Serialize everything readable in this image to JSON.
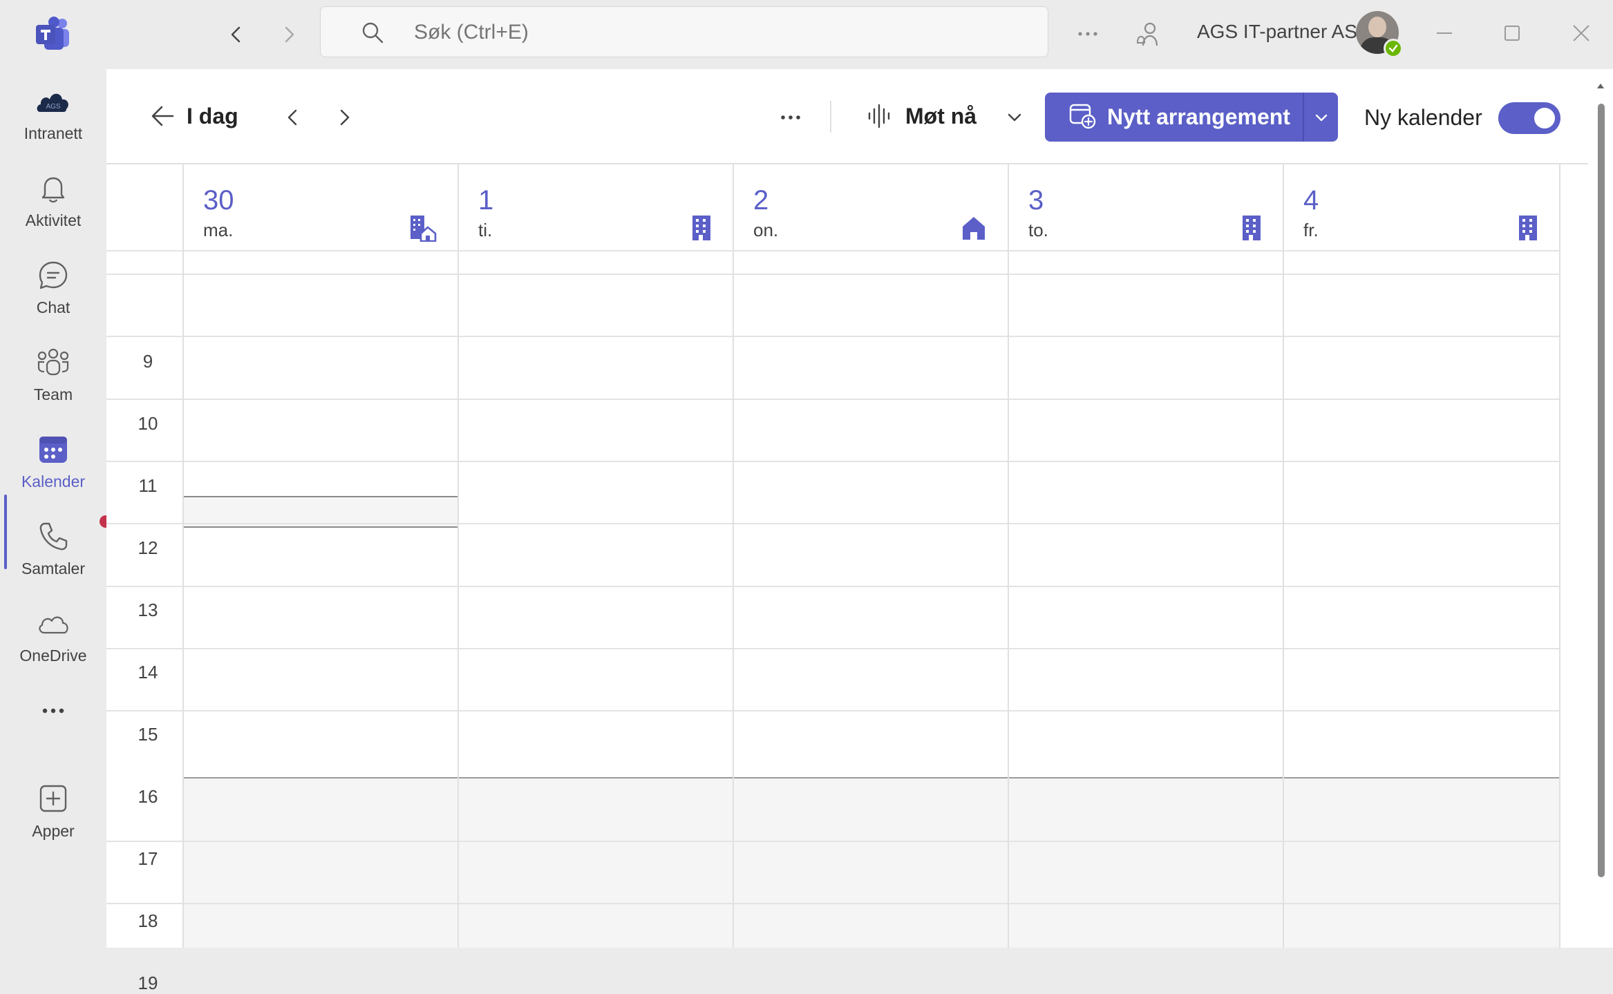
{
  "titlebar": {
    "search_placeholder": "Søk (Ctrl+E)",
    "org_name": "AGS IT-partner AS"
  },
  "rail": {
    "items": [
      {
        "label": "Intranett",
        "icon": "ags-cloud-icon"
      },
      {
        "label": "Aktivitet",
        "icon": "bell-icon"
      },
      {
        "label": "Chat",
        "icon": "chat-icon"
      },
      {
        "label": "Team",
        "icon": "teams-people-icon"
      },
      {
        "label": "Kalender",
        "icon": "calendar-icon",
        "active": true
      },
      {
        "label": "Samtaler",
        "icon": "phone-icon",
        "badge": true
      },
      {
        "label": "OneDrive",
        "icon": "cloud-icon"
      },
      {
        "label": "",
        "icon": "more-icon"
      },
      {
        "label": "Apper",
        "icon": "add-app-icon"
      }
    ],
    "logo_text": "AGS"
  },
  "toolbar": {
    "today_label": "I dag",
    "meet_now_label": "Møt nå",
    "new_event_label": "Nytt arrangement",
    "new_calendar_label": "Ny kalender",
    "new_calendar_enabled": true
  },
  "calendar": {
    "days": [
      {
        "num": "30",
        "name": "ma.",
        "location_icon": "office-home-icon"
      },
      {
        "num": "1",
        "name": "ti.",
        "location_icon": "office-building-icon"
      },
      {
        "num": "2",
        "name": "on.",
        "location_icon": "home-icon"
      },
      {
        "num": "3",
        "name": "to.",
        "location_icon": "office-building-icon"
      },
      {
        "num": "4",
        "name": "fr.",
        "location_icon": "office-building-icon"
      }
    ],
    "hours": [
      "9",
      "10",
      "11",
      "12",
      "13",
      "14",
      "15",
      "16",
      "17",
      "18",
      "19"
    ]
  },
  "colors": {
    "accent": "#5b5fc7",
    "rail_background": "#ebebeb",
    "after_hours": "#f5f5f5",
    "notification": "#c4314b",
    "presence": "#6bb700"
  }
}
